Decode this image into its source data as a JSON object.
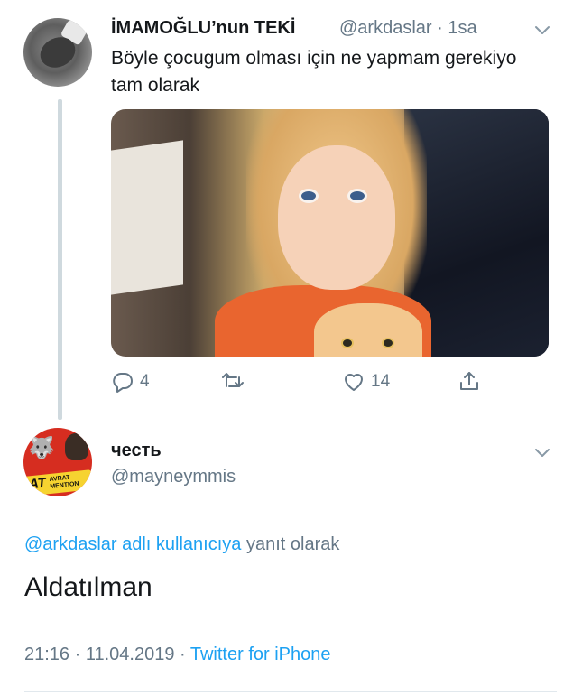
{
  "tweet1": {
    "display_name": "İMAMOĞLU’nun TEKİ",
    "handle": "@arkdaslar",
    "separator": " · ",
    "time": "1sa",
    "text": "Böyle çocugum olması için ne yapmam gerekiyo tam olarak",
    "stats": {
      "replies": "4",
      "retweets": "",
      "likes": "14"
    }
  },
  "tweet2": {
    "display_name": "честь",
    "handle": "@mayneymmis",
    "replying_to_mention": "@arkdaslar adlı kullanıcıya",
    "replying_to_suffix": " yanıt olarak",
    "text": "Aldatılman",
    "timestamp": "21:16 · 11.04.2019 · ",
    "source": "Twitter for iPhone",
    "avatar_badge_main": "AT",
    "avatar_badge_small_1": "AVRAT",
    "avatar_badge_small_2": "MENTION"
  },
  "icons": {
    "reply": "reply-icon",
    "retweet": "retweet-icon",
    "like": "heart-icon",
    "share": "share-icon",
    "more": "chevron-down-icon"
  },
  "colors": {
    "link": "#1da1f2",
    "secondary_text": "#657786",
    "primary_text": "#14171a",
    "thread_line": "#cfd9de"
  }
}
